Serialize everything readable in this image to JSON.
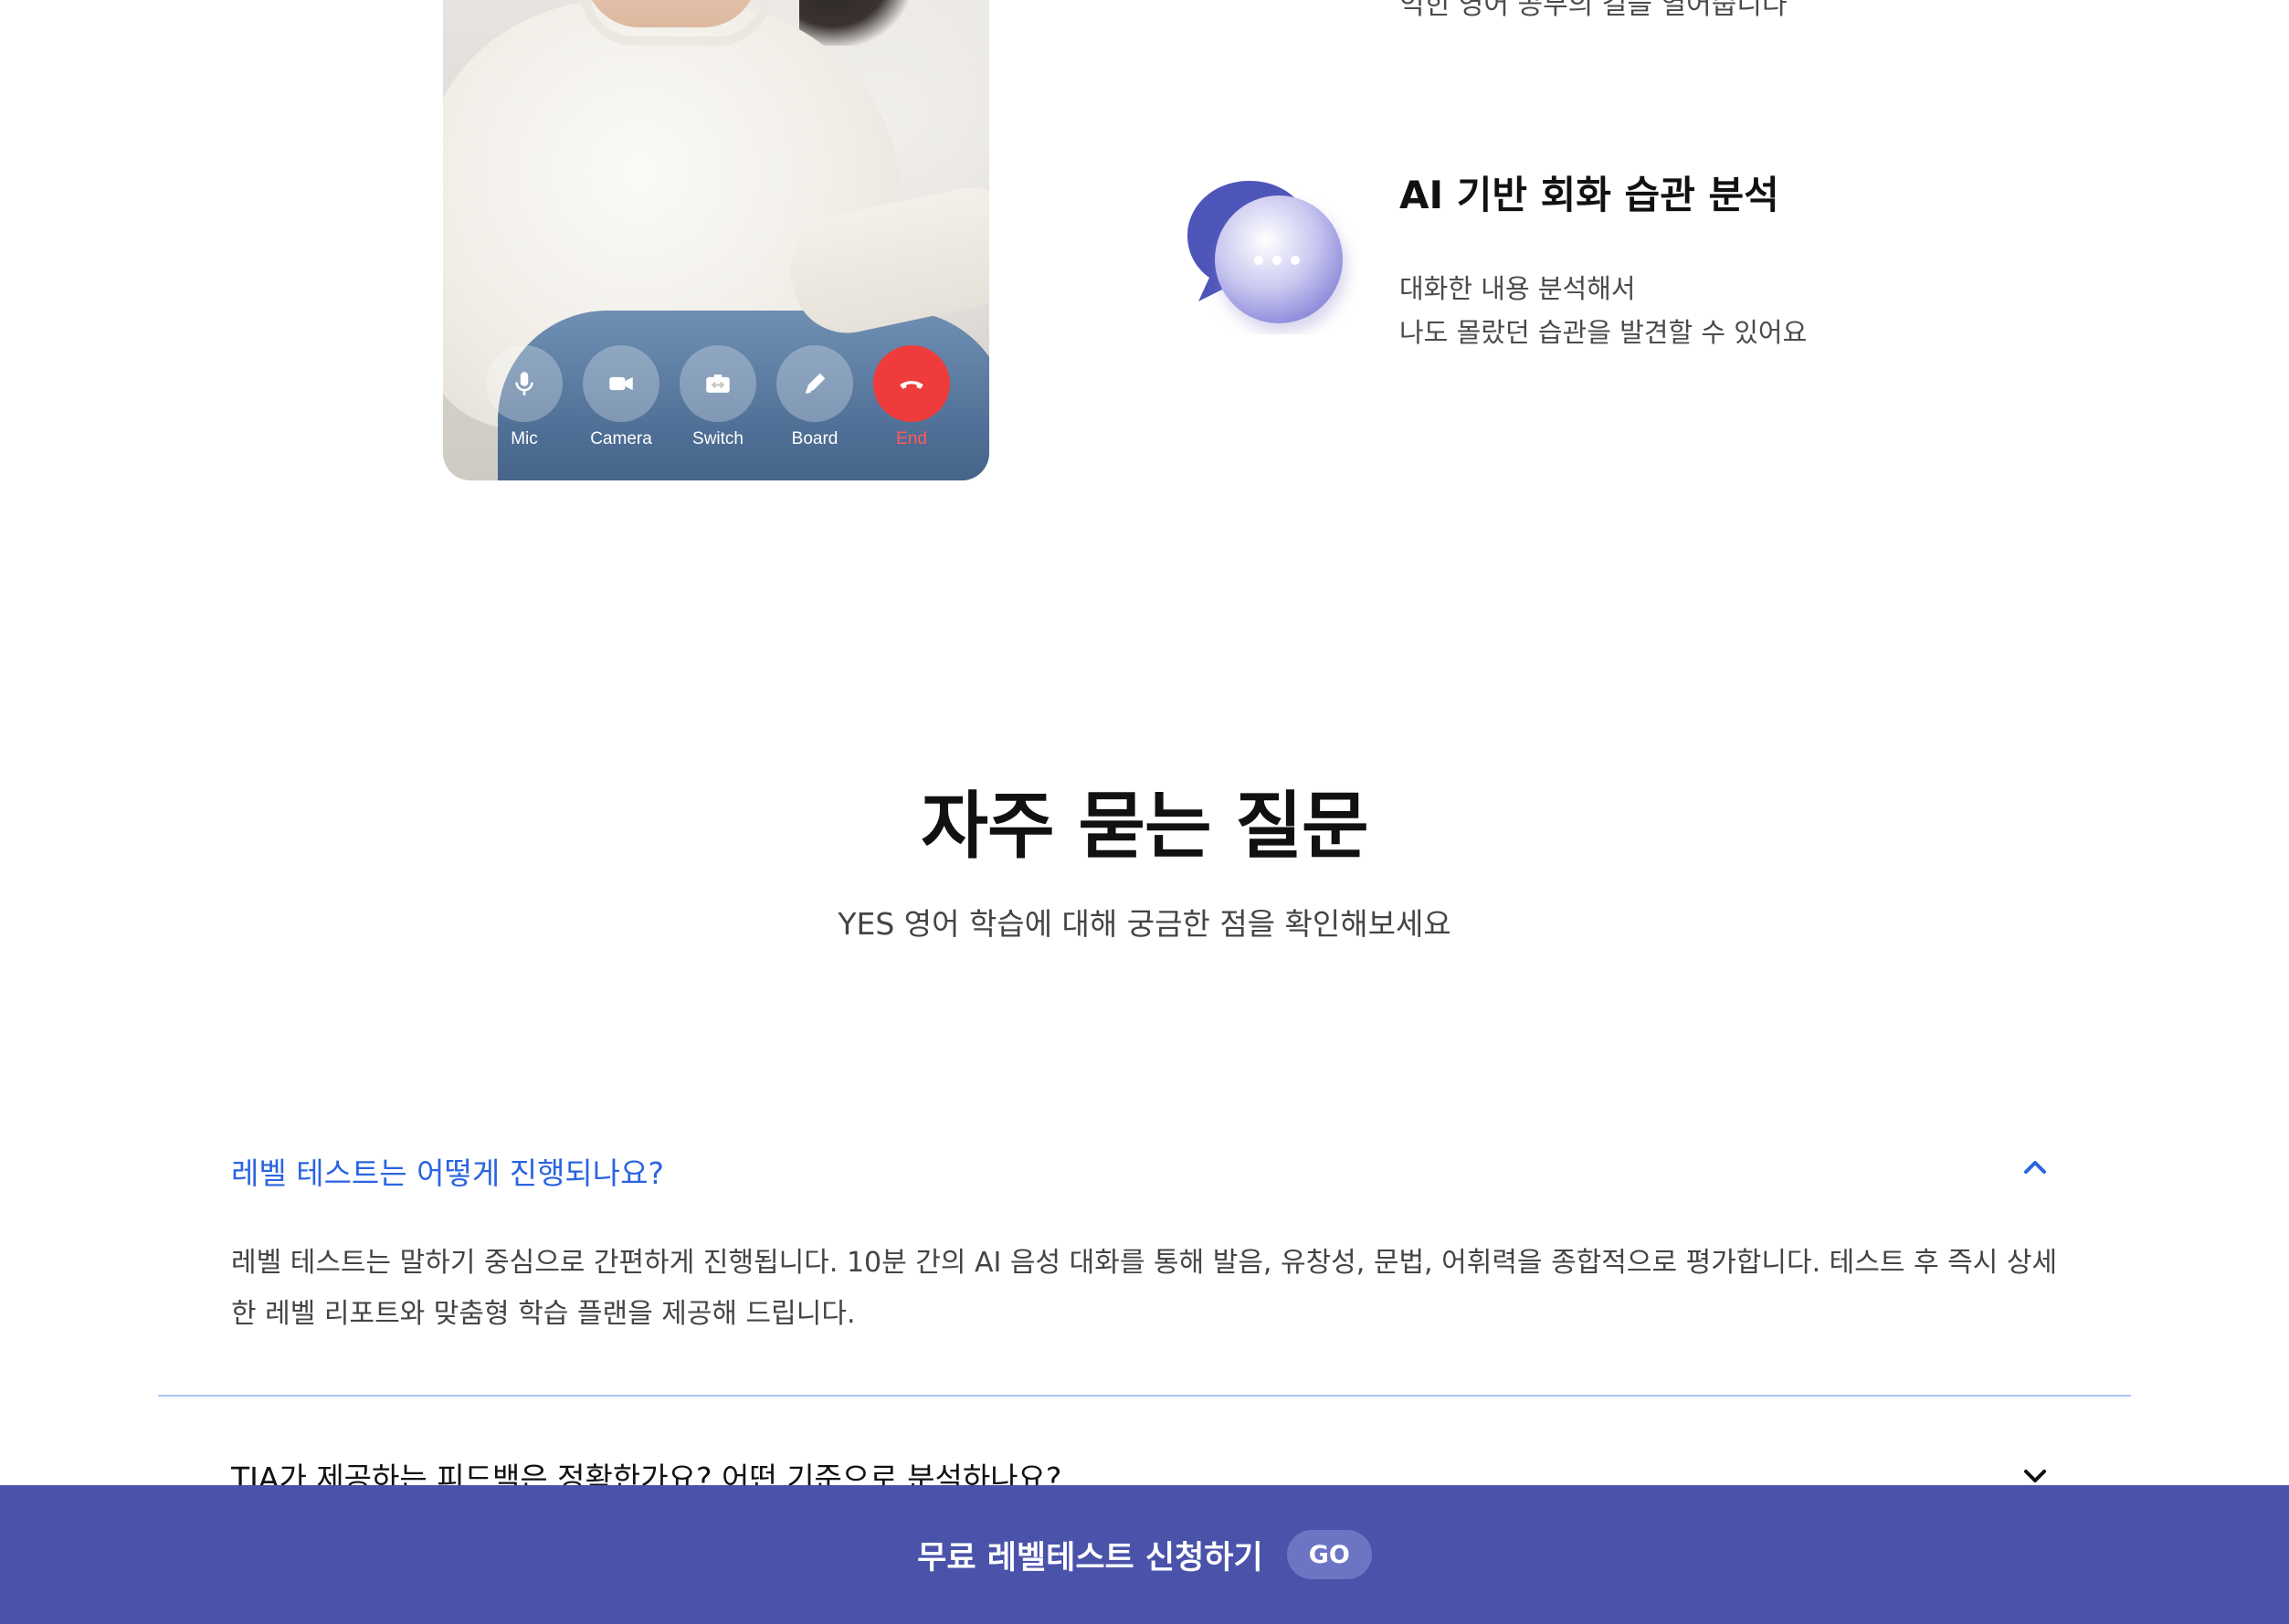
{
  "phone": {
    "controls": [
      {
        "label": "Mic",
        "icon": "mic-icon"
      },
      {
        "label": "Camera",
        "icon": "camera-icon"
      },
      {
        "label": "Switch",
        "icon": "switch-camera-icon"
      },
      {
        "label": "Board",
        "icon": "pen-icon"
      },
      {
        "label": "End",
        "icon": "phone-end-icon"
      }
    ]
  },
  "features": {
    "prev_desc": "익힌 영어 공부의 길을 열어줍니다",
    "ai_analysis": {
      "title": "AI 기반 회화 습관 분석",
      "desc_line1": "대화한 내용 분석해서",
      "desc_line2": "나도 몰랐던 습관을 발견할 수 있어요",
      "icon": "chat-bubbles-icon"
    }
  },
  "faq": {
    "title": "자주 묻는 질문",
    "subtitle": "YES 영어 학습에 대해 궁금한 점을 확인해보세요",
    "items": [
      {
        "question": "레벨 테스트는 어떻게 진행되나요?",
        "answer": "레벨 테스트는 말하기 중심으로 간편하게 진행됩니다. 10분 간의 AI 음성 대화를 통해 발음, 유창성, 문법, 어휘력을 종합적으로 평가합니다. 테스트 후 즉시 상세한 레벨 리포트와 맞춤형 학습 플랜을 제공해 드립니다.",
        "expanded": true
      },
      {
        "question": "TIA가 제공하는 피드백은 정확한가요? 어떤 기준으로 분석하나요?",
        "expanded": false
      }
    ]
  },
  "cta": {
    "label": "무료 레벨테스트 신청하기",
    "button": "GO",
    "bar_color": "#4a52aa"
  },
  "colors": {
    "accent": "#2a64e0",
    "end_call": "#ef3b3b",
    "divider": "#a9c6f7"
  }
}
